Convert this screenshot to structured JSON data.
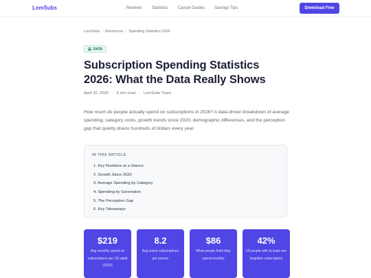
{
  "brand": {
    "logo": "LemSubs",
    "accent": "#4f46e5"
  },
  "nav": {
    "links": [
      "Reviews",
      "Statistics",
      "Cancel Guides",
      "Savings Tips"
    ],
    "cta": "Download Free"
  },
  "breadcrumb": [
    "LemSubs",
    "Resources",
    "Spending Statistics 2026"
  ],
  "badge": {
    "label": "DATA",
    "icon": "chart-icon"
  },
  "article": {
    "title": "Subscription Spending Statistics 2026: What the Data Really Shows",
    "date": "April 20, 2026",
    "read_time": "6 min read",
    "author": "LemSubs Team",
    "intro": "How much do people actually spend on subscriptions in 2026? A data-driven breakdown of average spending, category costs, growth trends since 2020, demographic differences, and the perception gap that quietly drains hundreds of dollars every year."
  },
  "toc": {
    "title": "IN THIS ARTICLE",
    "items": [
      "1. Key Numbers at a Glance",
      "2. Growth Since 2020",
      "3. Average Spending by Category",
      "4. Spending by Generation",
      "5. The Perception Gap",
      "6. Key Takeaways"
    ]
  },
  "stats": [
    {
      "value": "$219",
      "label": "Avg monthly spend on subscriptions per US adult (2026)"
    },
    {
      "value": "8.2",
      "label": "Avg active subscriptions per person"
    },
    {
      "value": "$86",
      "label": "What people think they spend monthly"
    },
    {
      "value": "42%",
      "label": "Of people with at least one forgotten subscription"
    }
  ]
}
